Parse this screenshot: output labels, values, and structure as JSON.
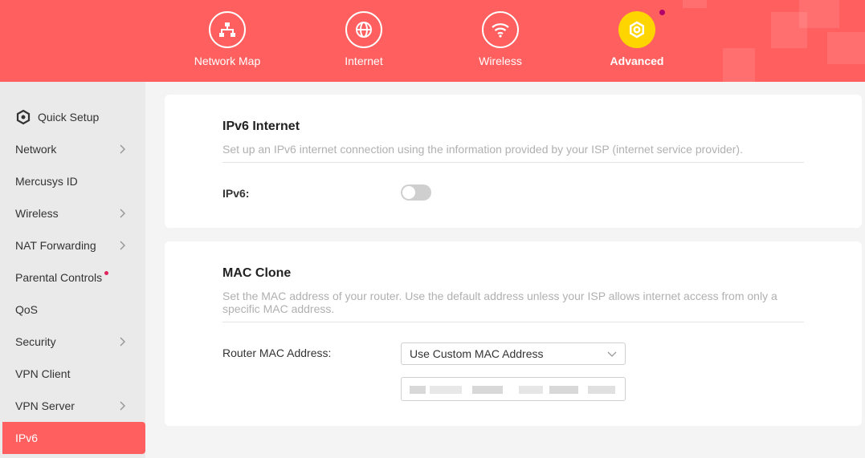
{
  "header": {
    "nav": [
      {
        "label": "Network Map",
        "icon": "network-map-icon"
      },
      {
        "label": "Internet",
        "icon": "globe-icon"
      },
      {
        "label": "Wireless",
        "icon": "wifi-icon"
      },
      {
        "label": "Advanced",
        "icon": "gear-icon",
        "active": true
      }
    ],
    "colors": {
      "bar": "#ff5f5f",
      "active_circle": "#ffd500",
      "notification_dot": "#b3006b"
    }
  },
  "sidebar": {
    "items": [
      {
        "label": "Quick Setup",
        "icon": "quick-setup-icon"
      },
      {
        "label": "Network",
        "has_submenu": true
      },
      {
        "label": "Mercusys ID"
      },
      {
        "label": "Wireless",
        "has_submenu": true
      },
      {
        "label": "NAT Forwarding",
        "has_submenu": true
      },
      {
        "label": "Parental Controls",
        "badge": true
      },
      {
        "label": "QoS"
      },
      {
        "label": "Security",
        "has_submenu": true
      },
      {
        "label": "VPN Client"
      },
      {
        "label": "VPN Server",
        "has_submenu": true
      },
      {
        "label": "IPv6",
        "active": true
      }
    ]
  },
  "ipv6_internet": {
    "title": "IPv6 Internet",
    "description": "Set up an IPv6 internet connection using the information provided by your ISP (internet service provider).",
    "toggle_label": "IPv6:",
    "toggle_on": false
  },
  "mac_clone": {
    "title": "MAC Clone",
    "description": "Set the MAC address of your router. Use the default address unless your ISP allows internet access from only a specific MAC address.",
    "field_label": "Router MAC Address:",
    "select_value": "Use Custom MAC Address",
    "mac_value_blurred": true
  }
}
